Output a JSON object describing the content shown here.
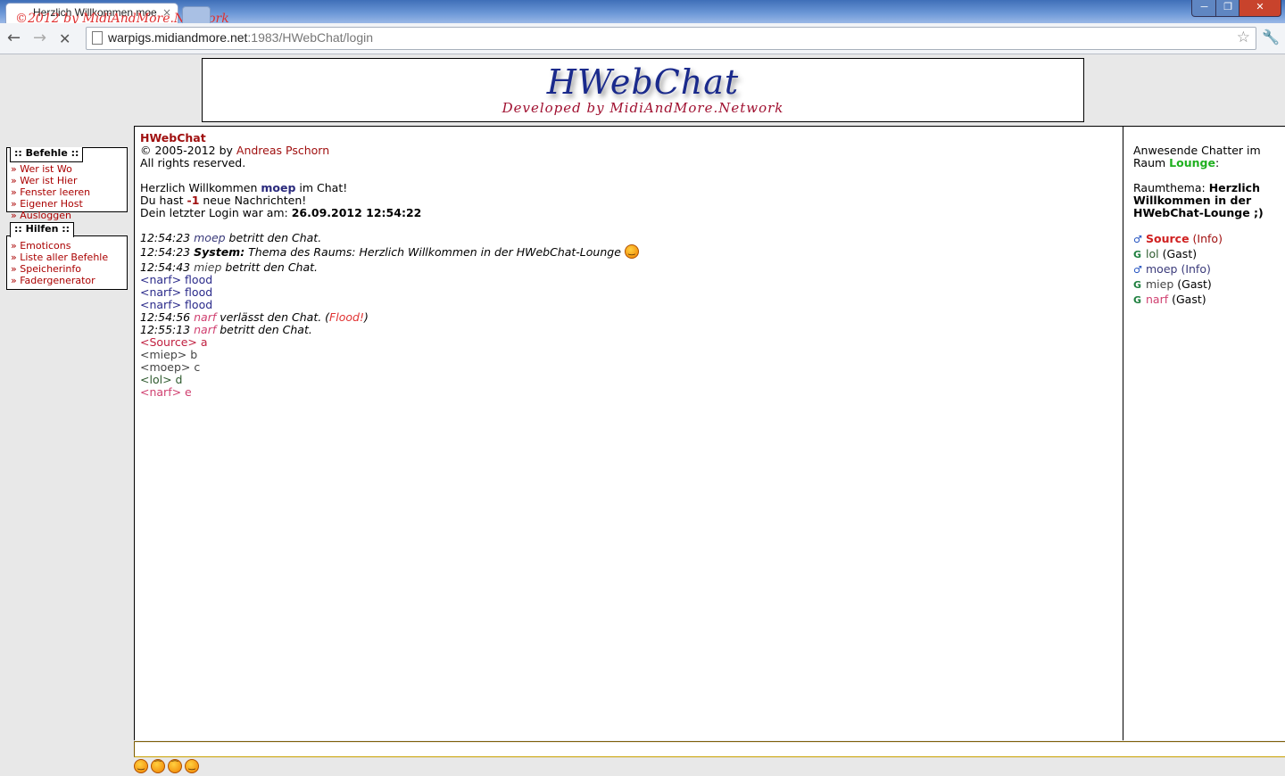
{
  "browser": {
    "tab_title": "Herzlich Willkommen moe",
    "tab_watermark": "©2012 by MidiAndMore.Network",
    "tab_close": "×",
    "url_host": "warpigs.midiandmore.net",
    "url_rest": ":1983/HWebChat/login",
    "icons": [
      "back-arrow-icon",
      "forward-arrow-icon",
      "stop-icon",
      "page-icon",
      "star-icon",
      "wrench-icon"
    ]
  },
  "banner": {
    "title": "HWebChat",
    "subtitle": "Developed by MidiAndMore.Network"
  },
  "befehle": {
    "heading": ":: Befehle ::",
    "items": [
      "Wer ist Wo",
      "Wer ist Hier",
      "Fenster leeren",
      "Eigener Host",
      "Ausloggen"
    ]
  },
  "hilfen": {
    "heading": ":: Hilfen ::",
    "items": [
      "Emoticons",
      "Liste aller Befehle",
      "Speicherinfo",
      "Fadergenerator"
    ]
  },
  "chat": {
    "app_name": "HWebChat",
    "copyright_prefix": "© 2005-2012 by ",
    "author": "Andreas Pschorn",
    "rights": "All rights reserved.",
    "welcome_prefix": "Herzlich Willkommen ",
    "welcome_user": "moep",
    "welcome_suffix": " im Chat!",
    "messages_prefix": "Du hast ",
    "messages_count": "-1",
    "messages_suffix": " neue Nachrichten!",
    "last_login_prefix": "Dein letzter Login war am: ",
    "last_login": "26.09.2012 12:54:22",
    "lines": {
      "l1_time": "12:54:23",
      "l1_nick": "moep",
      "l1_text": " betritt den Chat.",
      "l2_time": "12:54:23",
      "l2_system": "System:",
      "l2_text": " Thema des Raums: Herzlich Willkommen in der HWebChat-Lounge",
      "l3_time": "12:54:43",
      "l3_nick": "miep",
      "l3_text": " betritt den Chat.",
      "l4": "<narf> flood",
      "l5": "<narf> flood",
      "l6": "<narf> flood",
      "l7_time": "12:54:56",
      "l7_nick": "narf",
      "l7_text": " verlässt den Chat. (",
      "l7_reason": "Flood!",
      "l7_close": ")",
      "l8_time": "12:55:13",
      "l8_nick": "narf",
      "l8_text": " betritt den Chat.",
      "l9": "<Source> a",
      "l10": "<miep> b",
      "l11": "<moep> c",
      "l12": "<lol> d",
      "l13": "<narf> e"
    }
  },
  "sidebar": {
    "present_text": "Anwesende Chatter im Raum ",
    "room": "Lounge",
    "colon": ":",
    "topic_label": "Raumthema: ",
    "topic": "Herzlich Willkommen in der HWebChat-Lounge ;)",
    "users": [
      {
        "icon": "♂",
        "name": "Source",
        "tag": "(Info)"
      },
      {
        "icon": "G",
        "name": "lol",
        "tag": "(Gast)"
      },
      {
        "icon": "♂",
        "name": "moep",
        "tag": "(Info)"
      },
      {
        "icon": "G",
        "name": "miep",
        "tag": "(Gast)"
      },
      {
        "icon": "G",
        "name": "narf",
        "tag": "(Gast)"
      }
    ]
  },
  "smileys": [
    "smile-icon",
    "frown-icon",
    "frown-icon",
    "smile-icon"
  ]
}
